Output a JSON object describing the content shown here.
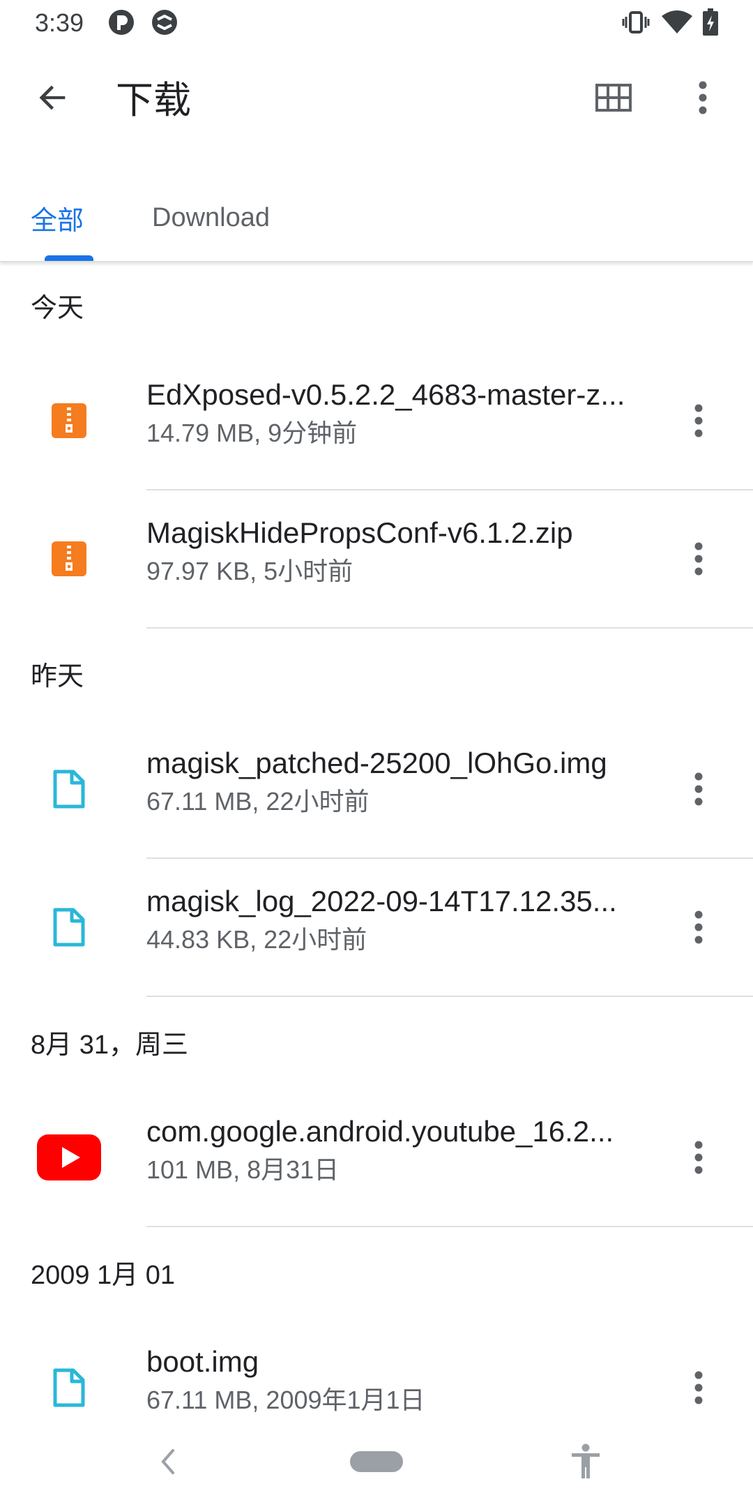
{
  "status_bar": {
    "time": "3:39",
    "left_icons": [
      "app-notification-icon",
      "sync-notification-icon"
    ],
    "right_icons": [
      "vibrate-icon",
      "wifi-icon",
      "battery-charging-icon"
    ]
  },
  "app_bar": {
    "title": "下载",
    "back_icon": "arrow-back-icon",
    "view_toggle_icon": "grid-view-icon",
    "overflow_icon": "more-vert-icon"
  },
  "tabs": [
    {
      "label": "全部",
      "selected": true
    },
    {
      "label": "Download",
      "selected": false
    }
  ],
  "accent_color": "#1a73e8",
  "sections": [
    {
      "header": "今天",
      "items": [
        {
          "name": "EdXposed-v0.5.2.2_4683-master-z...",
          "meta": "14.79 MB, 9分钟前",
          "icon": "zip-file-icon",
          "icon_color": "#f57c1f"
        },
        {
          "name": "MagiskHidePropsConf-v6.1.2.zip",
          "meta": "97.97 KB, 5小时前",
          "icon": "zip-file-icon",
          "icon_color": "#f57c1f"
        }
      ]
    },
    {
      "header": "昨天",
      "items": [
        {
          "name": "magisk_patched-25200_lOhGo.img",
          "meta": "67.11 MB, 22小时前",
          "icon": "document-file-icon",
          "icon_color": "#2ab7d9"
        },
        {
          "name": "magisk_log_2022-09-14T17.12.35...",
          "meta": "44.83 KB, 22小时前",
          "icon": "document-file-icon",
          "icon_color": "#2ab7d9"
        }
      ]
    },
    {
      "header": "8月 31，周三",
      "items": [
        {
          "name": "com.google.android.youtube_16.2...",
          "meta": "101 MB, 8月31日",
          "icon": "youtube-app-icon",
          "icon_color": "#ff0000"
        }
      ]
    },
    {
      "header": "2009 1月 01",
      "items": [
        {
          "name": "boot.img",
          "meta": "67.11 MB, 2009年1月1日",
          "icon": "document-file-icon",
          "icon_color": "#2ab7d9"
        }
      ]
    }
  ],
  "nav_bar": {
    "back_icon": "nav-back-icon",
    "home_icon": "nav-home-pill-icon",
    "accessibility_icon": "accessibility-icon"
  }
}
